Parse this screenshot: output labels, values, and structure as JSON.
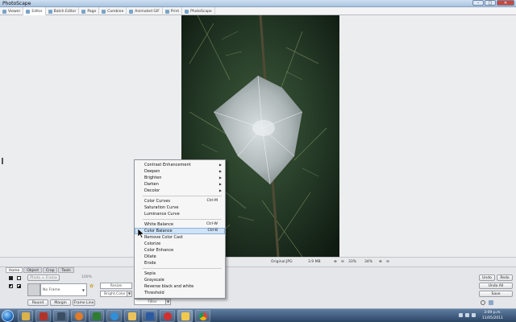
{
  "window": {
    "title": "PhotoScape",
    "minimize": "–",
    "maximize": "□",
    "close": "✕"
  },
  "app_tabs": [
    {
      "label": "Viewer",
      "icon": "viewer-icon",
      "active": false
    },
    {
      "label": "Editor",
      "icon": "editor-icon",
      "active": true
    },
    {
      "label": "Batch Editor",
      "icon": "batch-editor-icon",
      "active": false
    },
    {
      "label": "Page",
      "icon": "page-icon",
      "active": false
    },
    {
      "label": "Combine",
      "icon": "combine-icon",
      "active": false
    },
    {
      "label": "Animated GIF",
      "icon": "gif-icon",
      "active": false
    },
    {
      "label": "Print",
      "icon": "print-icon",
      "active": false
    },
    {
      "label": "PhotoScape",
      "icon": "photoscape-icon",
      "active": false
    }
  ],
  "status": {
    "filename": "Original.JPG",
    "filesize": "3.9 MB",
    "zoom_a": "33%",
    "zoom_b": "34%"
  },
  "bottom_tabs": [
    {
      "label": "Home",
      "active": true
    },
    {
      "label": "Object",
      "active": false
    },
    {
      "label": "Crop",
      "active": false
    },
    {
      "label": "Tools",
      "active": false
    }
  ],
  "home": {
    "photo_frame_label": "Photo + Frame",
    "frame_pct": "100%",
    "frame_select": "No Frame",
    "round_label": "Round",
    "margin_label": "Margin",
    "frame_line_label": "Frame Line",
    "resize_label": "Resize",
    "bright_color_label": "Bright,Color",
    "filter_label": "Filter"
  },
  "right_buttons": {
    "undo": "Undo",
    "redo": "Redo",
    "undo_all": "Undo All",
    "save": "Save"
  },
  "filter_menu": [
    {
      "label": "Contrast Enhancement",
      "submenu": true
    },
    {
      "label": "Deepen",
      "submenu": true
    },
    {
      "label": "Brighten",
      "submenu": true
    },
    {
      "label": "Darken",
      "submenu": true
    },
    {
      "label": "Decolor",
      "submenu": true
    },
    {
      "separator": true
    },
    {
      "label": "Color Curves",
      "shortcut": "Ctrl-M"
    },
    {
      "label": "Saturation Curve"
    },
    {
      "label": "Luminance Curve"
    },
    {
      "separator": true
    },
    {
      "label": "White Balance",
      "shortcut": "Ctrl-W"
    },
    {
      "label": "Color Balance",
      "shortcut": "Ctrl-B",
      "highlighted": true
    },
    {
      "label": "Remove Color Cast"
    },
    {
      "label": "Colorize"
    },
    {
      "label": "Color Enhance"
    },
    {
      "label": "Dilate"
    },
    {
      "label": "Erode"
    },
    {
      "separator": true
    },
    {
      "label": "Sepia"
    },
    {
      "label": "Grayscale"
    },
    {
      "label": "Reverse black and white"
    },
    {
      "label": "Threshold"
    }
  ],
  "taskbar": {
    "apps": [
      "windows-explorer-icon",
      "pdf-icon",
      "lightroom-icon",
      "media-player-icon",
      "excel-icon",
      "internet-explorer-icon",
      "folder-icon",
      "word-icon",
      "opera-icon",
      "photoscape-icon",
      "chrome-icon"
    ],
    "time": "3:09 p.m.",
    "date": "11/05/2011"
  },
  "colors": {
    "menu_highlight": "#cfe2f6",
    "close_button": "#c9483b",
    "taskbar": "#2b4565"
  }
}
